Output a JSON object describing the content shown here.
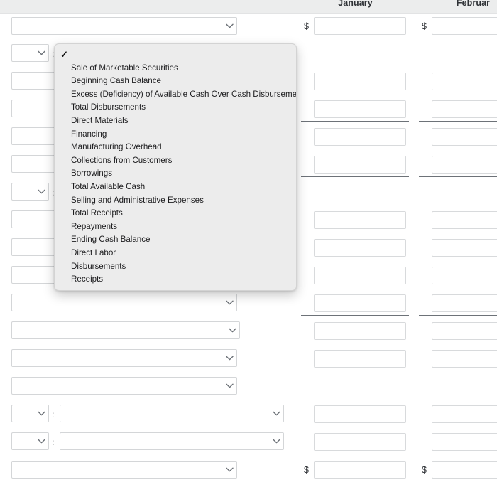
{
  "header": {
    "columns": [
      {
        "label": "January"
      },
      {
        "label": "Februar"
      }
    ]
  },
  "currency_symbol": "$",
  "colon_separator": ":",
  "dropdown": {
    "open": true,
    "selected_index": 0,
    "check_glyph": "✓",
    "items": [
      {
        "label": ""
      },
      {
        "label": "Sale of Marketable Securities"
      },
      {
        "label": "Beginning Cash Balance"
      },
      {
        "label": "Excess (Deficiency) of Available Cash Over Cash Disbursements"
      },
      {
        "label": "Total Disbursements"
      },
      {
        "label": "Direct Materials"
      },
      {
        "label": "Financing"
      },
      {
        "label": "Manufacturing Overhead"
      },
      {
        "label": "Collections from Customers"
      },
      {
        "label": "Borrowings"
      },
      {
        "label": "Total Available Cash"
      },
      {
        "label": "Selling and Administrative Expenses"
      },
      {
        "label": "Total Receipts"
      },
      {
        "label": "Repayments"
      },
      {
        "label": "Ending Cash Balance"
      },
      {
        "label": "Direct Labor"
      },
      {
        "label": "Disbursements"
      },
      {
        "label": "Receipts"
      }
    ]
  },
  "rows": {
    "labels": [
      {
        "type": "wide",
        "value": ""
      },
      {
        "type": "split",
        "small_value": "",
        "wide_value": ""
      },
      {
        "type": "wide",
        "value": ""
      },
      {
        "type": "wide",
        "value": ""
      },
      {
        "type": "wide",
        "value": ""
      },
      {
        "type": "wide",
        "value": ""
      },
      {
        "type": "split",
        "small_value": "",
        "wide_value": ""
      },
      {
        "type": "wide",
        "value": ""
      },
      {
        "type": "wide",
        "value": ""
      },
      {
        "type": "wide",
        "value": ""
      },
      {
        "type": "wide",
        "value": ""
      },
      {
        "type": "wide",
        "value": ""
      },
      {
        "type": "wide",
        "value": ""
      },
      {
        "type": "wide",
        "value": ""
      },
      {
        "type": "split",
        "small_value": "",
        "wide_value": ""
      },
      {
        "type": "split",
        "small_value": "",
        "wide_value": ""
      },
      {
        "type": "wide",
        "value": ""
      }
    ],
    "january": [
      "",
      "",
      "",
      "",
      "",
      "",
      "",
      "",
      "",
      "",
      "",
      "",
      "",
      "",
      "",
      "",
      ""
    ],
    "february": [
      "",
      "",
      "",
      "",
      "",
      "",
      "",
      "",
      "",
      "",
      "",
      "",
      "",
      "",
      "",
      "",
      ""
    ]
  },
  "colors": {
    "header_band": "#eceded",
    "popup_bg": "#ececec",
    "rule": "#6d7278",
    "field_border": "#d4d6d8",
    "text": "#1c1c1e"
  }
}
